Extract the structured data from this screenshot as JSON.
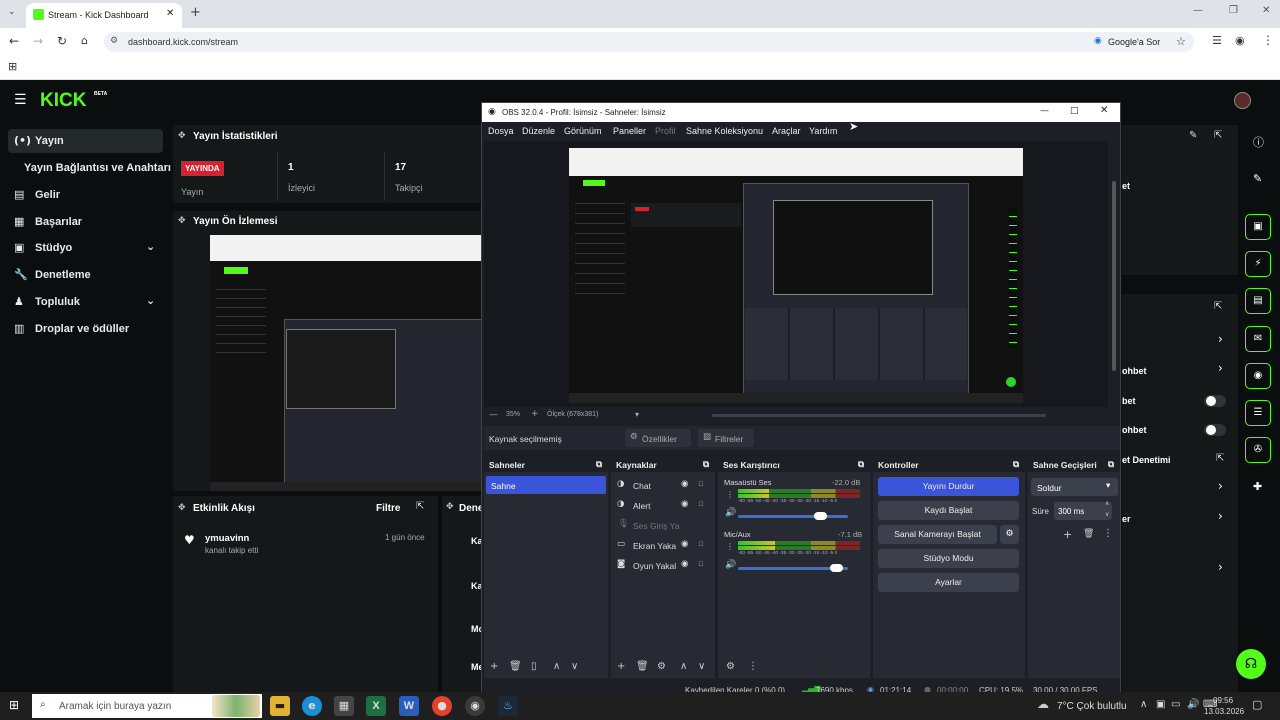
{
  "browser": {
    "tab_title": "Stream - Kick Dashboard",
    "url": "dashboard.kick.com/stream",
    "google_lens": "Google'a Sor"
  },
  "kick": {
    "logo": "KICK",
    "logo_sup": "BETA",
    "sidebar": [
      {
        "label": "Yayın",
        "icon": "broadcast-icon"
      },
      {
        "label": "Yayın Bağlantısı ve Anahtarı",
        "icon": ""
      },
      {
        "label": "Gelir",
        "icon": "income-icon"
      },
      {
        "label": "Başarılar",
        "icon": "trophy-icon"
      },
      {
        "label": "Stüdyo",
        "icon": "studio-icon"
      },
      {
        "label": "Denetleme",
        "icon": "wrench-icon"
      },
      {
        "label": "Topluluk",
        "icon": "community-icon"
      },
      {
        "label": "Droplar ve ödüller",
        "icon": "gift-icon"
      }
    ],
    "stats": {
      "header": "Yayın İstatistikleri",
      "live_badge": "YAYINDA",
      "live_label": "Yayın",
      "viewers_value": "1",
      "viewers_label": "İzleyici",
      "followers_value": "17",
      "followers_label": "Takipçi"
    },
    "preview_header": "Yayın Ön İzlemesi",
    "activity": {
      "header": "Etkinlik Akışı",
      "filter": "Filtre",
      "user": "ymuavinn",
      "action": "kanalı takip etti",
      "time": "1 gün önce"
    },
    "partial_panel_title": "Dene",
    "partial_list": [
      "Ka",
      "Ka",
      "Mo",
      "Me"
    ],
    "right_partial": [
      "et",
      "ohbet",
      "bet",
      "ohbet",
      "et Denetimi",
      "er"
    ]
  },
  "obs": {
    "title": "OBS 32.0.4 - Profil: İsimsiz - Sahneler: İsimsiz",
    "menu": [
      "Dosya",
      "Düzenle",
      "Görünüm",
      "Paneller",
      "Profil",
      "Sahne Koleksiyonu",
      "Araçlar",
      "Yardım"
    ],
    "zoom": "35%",
    "scale": "Ölçek (678x381)",
    "source_bar": {
      "no_source": "Kaynak seçilmemiş",
      "properties": "Özellikler",
      "filters": "Filtreler"
    },
    "scenes": {
      "title": "Sahneler",
      "items": [
        "Sahne"
      ]
    },
    "sources": {
      "title": "Kaynaklar",
      "items": [
        {
          "label": "Chat",
          "icon": "browser-source-icon"
        },
        {
          "label": "Alert",
          "icon": "browser-source-icon"
        },
        {
          "label": "Ses Giriş Ya",
          "icon": "microphone-icon"
        },
        {
          "label": "Ekran Yaka",
          "icon": "monitor-icon"
        },
        {
          "label": "Oyun Yakal",
          "icon": "gamepad-icon"
        }
      ]
    },
    "mixer": {
      "title": "Ses Karıştırıcı",
      "channels": [
        {
          "name": "Masaüstü Ses",
          "db": "-22.0 dB",
          "level": 0.25,
          "volume": 0.75
        },
        {
          "name": "Mic/Aux",
          "db": "-7.1 dB",
          "level": 0.3,
          "volume": 0.9
        }
      ],
      "scale": "-60 -55 -50 -45 -40 -35 -30 -25 -20 -15 -10 -5 0"
    },
    "controls": {
      "title": "Kontroller",
      "buttons": [
        "Yayını Durdur",
        "Kaydı Başlat",
        "Sanal Kamerayı Başlat",
        "Stüdyo Modu",
        "Ayarlar"
      ]
    },
    "transitions": {
      "title": "Sahne Geçişleri",
      "type": "Soldur",
      "duration_label": "Süre",
      "duration": "300 ms"
    },
    "status": {
      "dropped": "Kaybedilen Kareler 0 (%0.0)",
      "bitrate": "7690 kbps",
      "live_time": "01:21:14",
      "rec_time": "00:00:00",
      "cpu": "CPU: 19.5%",
      "fps": "30.00 / 30.00 FPS"
    }
  },
  "taskbar": {
    "search": "Aramak için buraya yazın",
    "weather": "7°C Çok bulutlu",
    "time": "09:56",
    "date": "13.03.2026"
  },
  "colors": {
    "kick_green": "#53fc18",
    "live_red": "#d6212f",
    "obs_blue": "#3a55d9"
  }
}
